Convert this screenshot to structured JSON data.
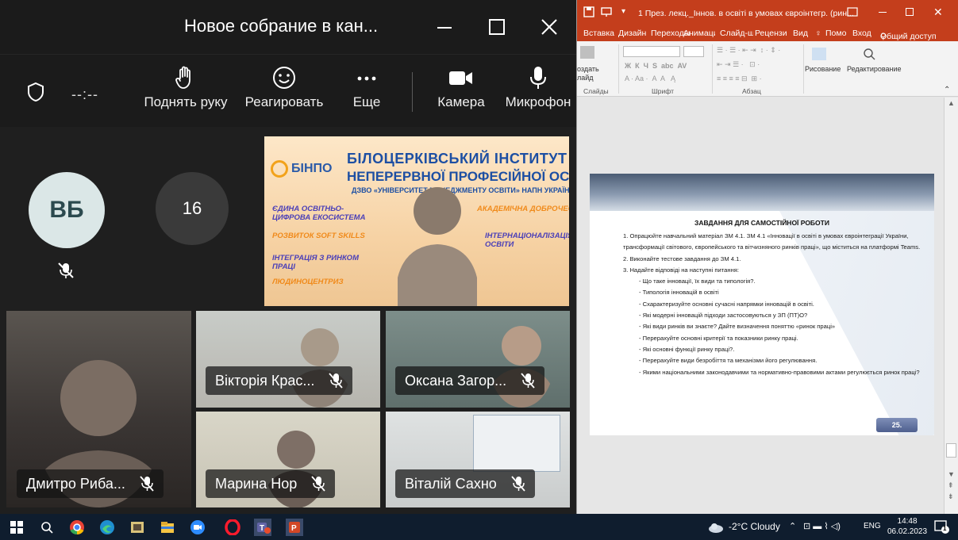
{
  "teams": {
    "title": "Новое собрание в кан...",
    "timer": "--:--",
    "toolbar": {
      "raise_hand": "Поднять руку",
      "react": "Реагировать",
      "more": "Еще",
      "camera": "Камера",
      "mic": "Микрофон"
    },
    "avatar_initials": "ВБ",
    "overflow_count": "16",
    "banner": {
      "logo": "БІНПО",
      "line1": "БІЛОЦЕРКІВСЬКИЙ ІНСТИТУТ",
      "line2": "НЕПЕРЕРВНОЇ ПРОФЕСІЙНОЇ ОСВІТИ",
      "line3": "ДЗВО «УНІВЕРСИТЕТ МЕНЕДЖМЕНТУ ОСВІТИ» НАПН УКРАЇНИ",
      "tag1": "ЄДИНА ОСВІТНЬО-ЦИФРОВА ЕКОСИСТЕМА",
      "tag2": "РОЗВИТОК SOFT SKILLS",
      "tag3": "ІНТЕГРАЦІЯ З РИНКОМ ПРАЦІ",
      "tag4": "ЛЮДИНОЦЕНТРИЗМ",
      "tag5": "АКАДЕМІЧНА ДОБРОЧЕСНІСТЬ",
      "tag6": "ІНТЕРНАЦІОНАЛІЗАЦІЯ ОСВІТИ"
    },
    "participants": [
      {
        "name": "Дмитро Риба..."
      },
      {
        "name": "Вікторія Крас..."
      },
      {
        "name": "Оксана Загор..."
      },
      {
        "name": "Марина Нор"
      },
      {
        "name": "Віталій Сахно"
      }
    ]
  },
  "ppt": {
    "title": "1 През. лекц._Іннов. в освіті в умовах євроінтегр. (рин...",
    "tabs": [
      "Вставка",
      "Дизайн",
      "Переходы",
      "Анимации",
      "Слайд-шо",
      "Рецензир",
      "Вид"
    ],
    "help": "Помо",
    "signin": "Вход",
    "share": "Общий доступ",
    "ribbon": {
      "create_slide_1": "оздать",
      "create_slide_2": "лайд",
      "group_slides": "Слайды",
      "group_font": "Шрифт",
      "group_paragraph": "Абзац",
      "drawing": "Рисование",
      "editing": "Редактирование"
    },
    "slide": {
      "heading": "ЗАВДАННЯ ДЛЯ САМОСТІЙНОЇ РОБОТИ",
      "item1": "1. Опрацюйте навчальний матеріал ЗМ 4.1. ЗМ 4.1 «Інновації в освіті в умовах євроінтеграції України, трансформації світового, європейського та вітчизняного ринків праці», що міститься на платформі Teams.",
      "item2": "2. Виконайте тестове завдання до ЗМ 4.1.",
      "item3": "3. Надайте відповіді на наступні питання:",
      "q1": "- Що таке інновації, їх види та типологія?.",
      "q2": "- Типологія інновацій в освіті",
      "q3": "- Схарактеризуйте основні сучасні напрямки інновацій в освіті.",
      "q4": "- Які модерні інновацій підходи застосовуються у ЗП (ПТ)О?",
      "q5": "- Які види ринків ви знаєте? Дайте визначення поняттю «ринок праці»",
      "q6": "- Перерахуйте основні критерії та показники ринку праці.",
      "q7": "- Які основні функції ринку праці?.",
      "q8": "- Перерахуйте види безробіття та механізми його регулювання.",
      "q9": "- Якими національними законодавчими та нормативно-правовими актами регулюється ринок праці?",
      "page_number": "25."
    }
  },
  "taskbar": {
    "weather": "-2°C  Cloudy",
    "lang": "ENG",
    "time": "14:48",
    "date": "06.02.2023",
    "notif_count": "1"
  }
}
